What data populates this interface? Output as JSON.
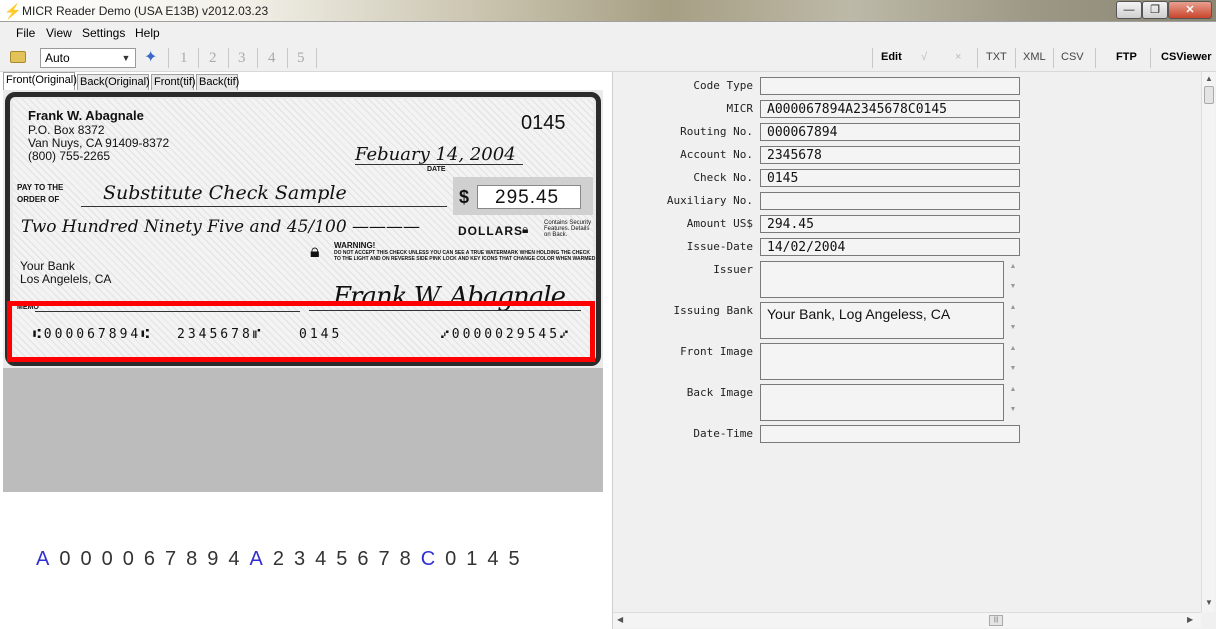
{
  "window": {
    "title": "MICR Reader Demo (USA E13B) v2012.03.23",
    "minimize": "—",
    "maximize": "❐",
    "close": "✕"
  },
  "menu": [
    "File",
    "View",
    "Settings",
    "Help"
  ],
  "toolbar": {
    "mode_value": "Auto",
    "pages": [
      "1",
      "2",
      "3",
      "4",
      "5"
    ],
    "edit_label": "Edit",
    "confirm_label": "√",
    "cancel_label": "×",
    "txt_label": "TXT",
    "xml_label": "XML",
    "csv_label": "CSV",
    "ftp_label": "FTP",
    "csviewer_label": "CSViewer"
  },
  "tabs": [
    "Front(Original)",
    "Back(Original)",
    "Front(tif)",
    "Back(tif)"
  ],
  "check": {
    "payer_name": "Frank W. Abagnale",
    "payer_address": [
      "P.O. Box 8372",
      "Van Nuys, CA  91409-8372",
      "(800) 755-2265"
    ],
    "check_number": "0145",
    "date": "Febuary 14, 2004",
    "date_label": "DATE",
    "pay_to_label": "PAY TO THE ORDER OF",
    "payee": "Substitute Check Sample",
    "currency_symbol": "$",
    "amount": "295.45",
    "amount_words": "Two Hundred Ninety Five and  45/100 ————",
    "dollars_label": "DOLLARS",
    "security_note": "Contains Security Features. Details on Back.",
    "warning_title": "WARNING!",
    "warning_text": "DO NOT ACCEPT THIS CHECK UNLESS YOU CAN SEE A TRUE WATERMARK WHEN HOLDING THE CHECK TO THE LIGHT AND ON REVERSE SIDE PINK LOCK AND KEY ICONS THAT CHANGE COLOR WHEN WARMED",
    "bank_name": "Your Bank",
    "bank_city": "Los Angelels, CA",
    "signature": "Frank W. Abagnale",
    "memo_label": "MEMO",
    "micr_routing": "⑆000067894⑆",
    "micr_account": "2345678⑈",
    "micr_check": "0145",
    "micr_amount": "⑇0000029545⑇"
  },
  "recognized_micr": [
    {
      "t": "A",
      "sym": true
    },
    {
      "t": "0"
    },
    {
      "t": "0"
    },
    {
      "t": "0"
    },
    {
      "t": "0"
    },
    {
      "t": "6"
    },
    {
      "t": "7"
    },
    {
      "t": "8"
    },
    {
      "t": "9"
    },
    {
      "t": "4"
    },
    {
      "t": "A",
      "sym": true
    },
    {
      "t": "2"
    },
    {
      "t": "3"
    },
    {
      "t": "4"
    },
    {
      "t": "5"
    },
    {
      "t": "6"
    },
    {
      "t": "7"
    },
    {
      "t": "8"
    },
    {
      "t": "C",
      "sym": true
    },
    {
      "t": "0"
    },
    {
      "t": "1"
    },
    {
      "t": "4"
    },
    {
      "t": "5"
    }
  ],
  "fields": [
    {
      "label": "Code Type",
      "value": "",
      "kind": "input"
    },
    {
      "label": "MICR",
      "value": "A000067894A2345678C0145",
      "kind": "input"
    },
    {
      "label": "Routing No.",
      "value": "000067894",
      "kind": "input"
    },
    {
      "label": "Account No.",
      "value": "2345678",
      "kind": "input"
    },
    {
      "label": "Check No.",
      "value": "0145",
      "kind": "input"
    },
    {
      "label": "Auxiliary No.",
      "value": "",
      "kind": "input"
    },
    {
      "label": "Amount US$",
      "value": "294.45",
      "kind": "input"
    },
    {
      "label": "Issue-Date",
      "value": "14/02/2004",
      "kind": "input"
    },
    {
      "label": "Issuer",
      "value": "",
      "kind": "area"
    },
    {
      "label": "Issuing Bank",
      "value": "Your Bank, Log Angeless, CA",
      "kind": "area"
    },
    {
      "label": "Front Image",
      "value": "",
      "kind": "area"
    },
    {
      "label": "Back Image",
      "value": "",
      "kind": "area"
    },
    {
      "label": "Date-Time",
      "value": "",
      "kind": "input"
    }
  ],
  "colors": {
    "highlight": "#ff0000",
    "micr_symbol": "#3030d0",
    "gray_area": "#bcbcbc"
  }
}
